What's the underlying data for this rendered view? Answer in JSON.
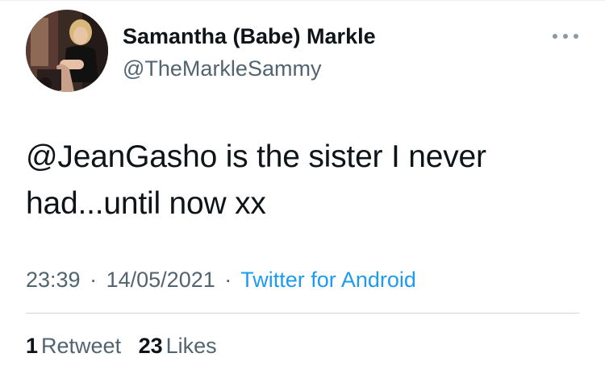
{
  "author": {
    "display_name": "Samantha (Babe) Markle",
    "handle": "@TheMarkleSammy"
  },
  "tweet": {
    "mention": "@JeanGasho",
    "text_line1_rest": " is the sister I never",
    "text_line2": "had...until now xx"
  },
  "meta": {
    "time": "23:39",
    "separator1": "·",
    "date": "14/05/2021",
    "separator2": "·",
    "source": "Twitter for Android"
  },
  "stats": {
    "retweets_count": "1",
    "retweets_label": "Retweet",
    "likes_count": "23",
    "likes_label": "Likes"
  },
  "icons": {
    "more": "more-horizontal-icon",
    "avatar": "profile-photo"
  },
  "colors": {
    "text_primary": "#0f1419",
    "text_secondary": "#536471",
    "link": "#1d9bf0",
    "divider": "#cfd9de"
  }
}
